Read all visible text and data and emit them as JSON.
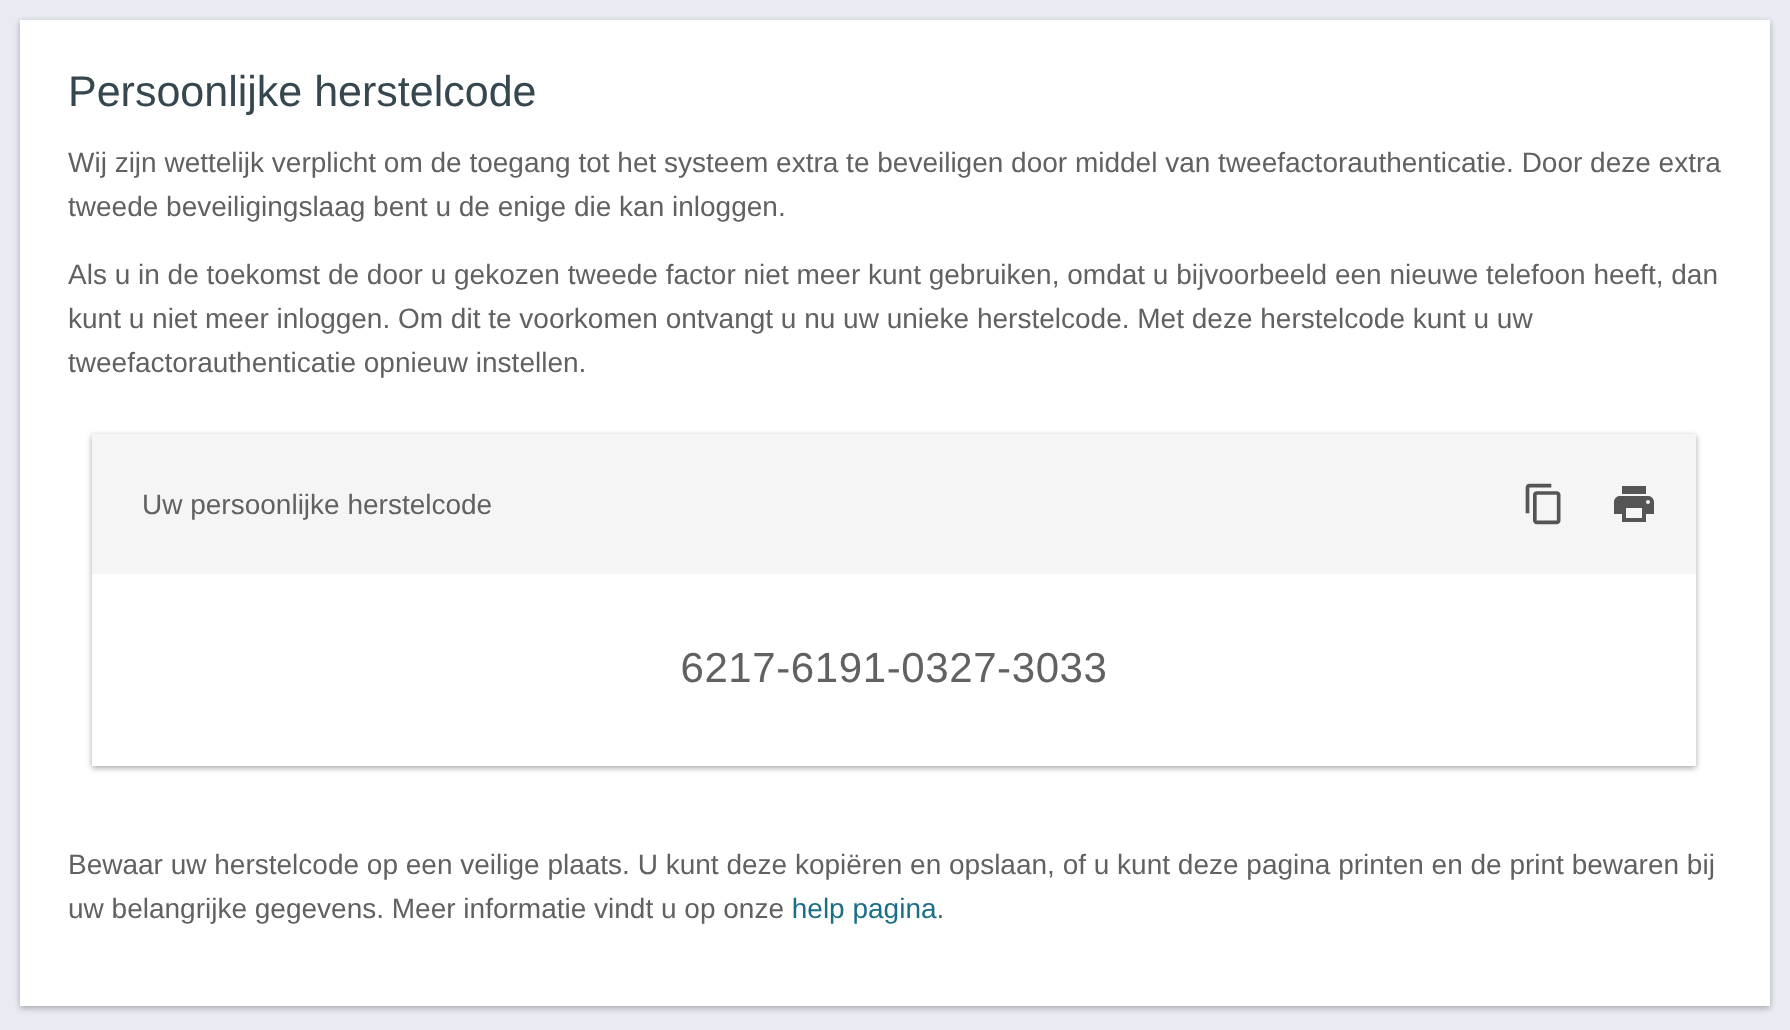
{
  "title": "Persoonlijke herstelcode",
  "paragraphs": [
    "Wij zijn wettelijk verplicht om de toegang tot het systeem extra te beveiligen door middel van tweefactorauthenticatie. Door deze extra tweede beveiligingslaag bent u de enige die kan inloggen.",
    "Als u in de toekomst de door u gekozen tweede factor niet meer kunt gebruiken, omdat u bijvoorbeeld een nieuwe telefoon heeft, dan kunt u niet meer inloggen. Om dit te voorkomen ontvangt u nu uw unieke herstelcode. Met deze herstelcode kunt u uw tweefactorauthenticatie opnieuw instellen."
  ],
  "code_card": {
    "label": "Uw persoonlijke herstelcode",
    "code": "6217-6191-0327-3033"
  },
  "footer": {
    "text": "Bewaar uw herstelcode op een veilige plaats. U kunt deze kopiëren en opslaan, of u kunt deze pagina printen en de print bewaren bij uw belangrijke gegevens. Meer informatie vindt u op onze ",
    "link": "help pagina",
    "text_after": "."
  }
}
